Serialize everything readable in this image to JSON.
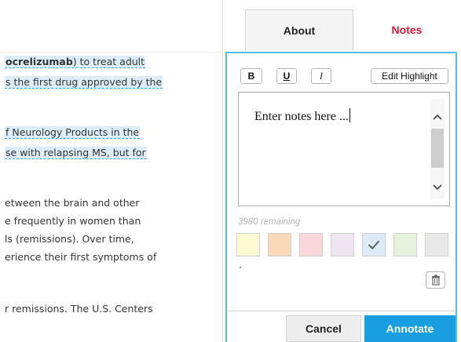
{
  "article": {
    "lines": [
      {
        "pre": "",
        "bold": "ocrelizumab",
        "post": ") to treat adult",
        "highlighted": true
      },
      {
        "pre": "s the first drug approved by the",
        "bold": "",
        "post": "",
        "highlighted": true
      },
      {
        "pre": "f Neurology Products in the",
        "bold": "",
        "post": "",
        "highlighted": true
      },
      {
        "pre": "se with relapsing MS, but for",
        "bold": "",
        "post": "",
        "highlighted": true
      },
      {
        "pre": "etween the brain and other",
        "bold": "",
        "post": "",
        "highlighted": false
      },
      {
        "pre": "e frequently in women than",
        "bold": "",
        "post": "",
        "highlighted": false
      },
      {
        "pre": "ls (remissions). Over time,",
        "bold": "",
        "post": "",
        "highlighted": false
      },
      {
        "pre": "erience their first symptoms of",
        "bold": "",
        "post": "",
        "highlighted": false
      },
      {
        "pre": "r remissions. The U.S. Centers",
        "bold": "",
        "post": "",
        "highlighted": false
      }
    ]
  },
  "tabs": {
    "about": "About",
    "notes": "Notes"
  },
  "toolbar": {
    "bold": "B",
    "underline": "U",
    "italic": "I",
    "edit_highlight": "Edit Highlight"
  },
  "notes": {
    "text": "Enter notes here ...",
    "remaining": "3980 remaining"
  },
  "swatches": [
    {
      "name": "yellow",
      "color": "#fdf9d3",
      "selected": false
    },
    {
      "name": "orange",
      "color": "#f7d9b8",
      "selected": false
    },
    {
      "name": "pink",
      "color": "#f9d6d8",
      "selected": false
    },
    {
      "name": "lavender",
      "color": "#eee4f2",
      "selected": false
    },
    {
      "name": "blue",
      "color": "#dcebf7",
      "selected": true
    },
    {
      "name": "green",
      "color": "#e6f2dc",
      "selected": false
    },
    {
      "name": "gray",
      "color": "#e8e8e8",
      "selected": false
    }
  ],
  "footer": {
    "cancel": "Cancel",
    "annotate": "Annotate"
  }
}
